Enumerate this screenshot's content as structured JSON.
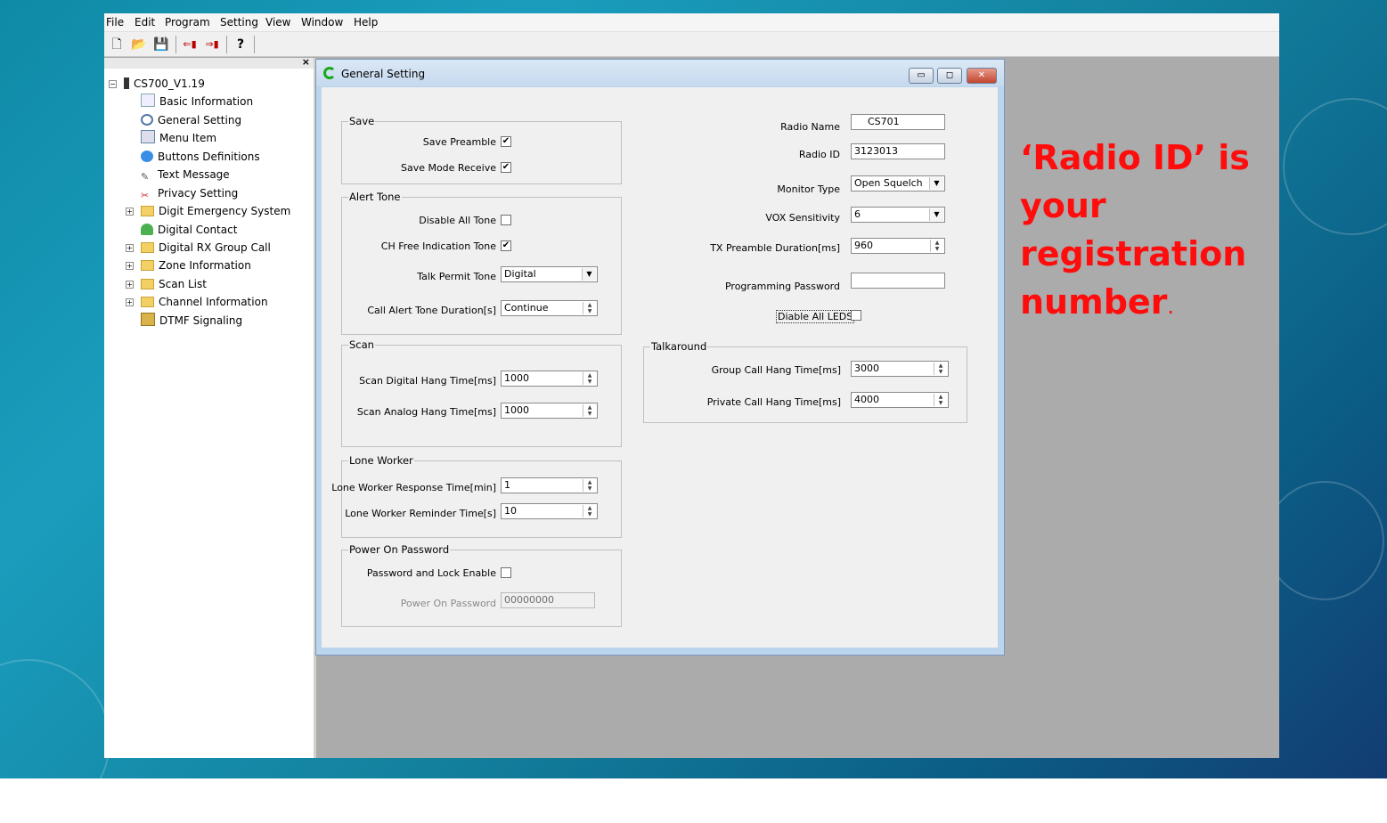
{
  "menubar": {
    "items": [
      "File",
      "Edit",
      "Program",
      "Setting",
      "View",
      "Window",
      "Help"
    ]
  },
  "toolbar": {
    "icons": [
      "new-file-icon",
      "open-folder-icon",
      "save-icon",
      "read-radio-icon",
      "write-radio-icon",
      "help-icon"
    ]
  },
  "tree": {
    "root": "CS700_V1.19",
    "items": [
      "Basic Information",
      "General Setting",
      "Menu Item",
      "Buttons Definitions",
      "Text Message",
      "Privacy Setting",
      "Digit Emergency System",
      "Digital Contact",
      "Digital RX Group Call",
      "Zone Information",
      "Scan List",
      "Channel Information",
      "DTMF Signaling"
    ]
  },
  "window": {
    "title": "General Setting",
    "min": "▭",
    "max": "◻",
    "close": "✕"
  },
  "save": {
    "label": "Save",
    "save_preamble": "Save Preamble",
    "save_preamble_checked": "✔",
    "save_mode_receive": "Save Mode Receive",
    "save_mode_receive_checked": "✔"
  },
  "alert_tone": {
    "label": "Alert Tone",
    "disable_all_tone": "Disable All Tone",
    "ch_free_indication_tone": "CH Free Indication Tone",
    "ch_free_checked": "✔",
    "talk_permit_tone": "Talk Permit Tone",
    "talk_permit_value": "Digital",
    "call_alert_tone_duration": "Call Alert Tone Duration[s]",
    "call_alert_value": "Continue"
  },
  "scan": {
    "label": "Scan",
    "digital_hang": "Scan Digital Hang Time[ms]",
    "digital_hang_value": "1000",
    "analog_hang": "Scan Analog Hang Time[ms]",
    "analog_hang_value": "1000"
  },
  "lone_worker": {
    "label": "Lone Worker",
    "response": "Lone Worker Response Time[min]",
    "response_value": "1",
    "reminder": "Lone Worker Reminder Time[s]",
    "reminder_value": "10"
  },
  "power_on": {
    "label": "Power On Password",
    "lock_enable": "Password and Lock Enable",
    "password": "Power On Password",
    "password_value": "00000000"
  },
  "radio": {
    "name_label": "Radio Name",
    "name_value": "CS701",
    "id_label": "Radio ID",
    "id_value": "3123013",
    "monitor_label": "Monitor Type",
    "monitor_value": "Open Squelch",
    "vox_label": "VOX Sensitivity",
    "vox_value": "6",
    "tx_preamble_label": "TX Preamble Duration[ms]",
    "tx_preamble_value": "960",
    "prog_password_label": "Programming Password",
    "prog_password_value": "",
    "disable_leds_label": "Diable All LEDS"
  },
  "talkaround": {
    "label": "Talkaround",
    "group_hang": "Group Call Hang Time[ms]",
    "group_hang_value": "3000",
    "private_hang": "Private Call Hang Time[ms]",
    "private_hang_value": "4000"
  },
  "overlay": {
    "line1": "‘Radio ID’ is",
    "line2": "your",
    "line3": "registration",
    "line4": "number",
    "dot": "."
  },
  "colors": {
    "overlay_text": "#ff0d0d",
    "window_border": "#7a98bd"
  }
}
